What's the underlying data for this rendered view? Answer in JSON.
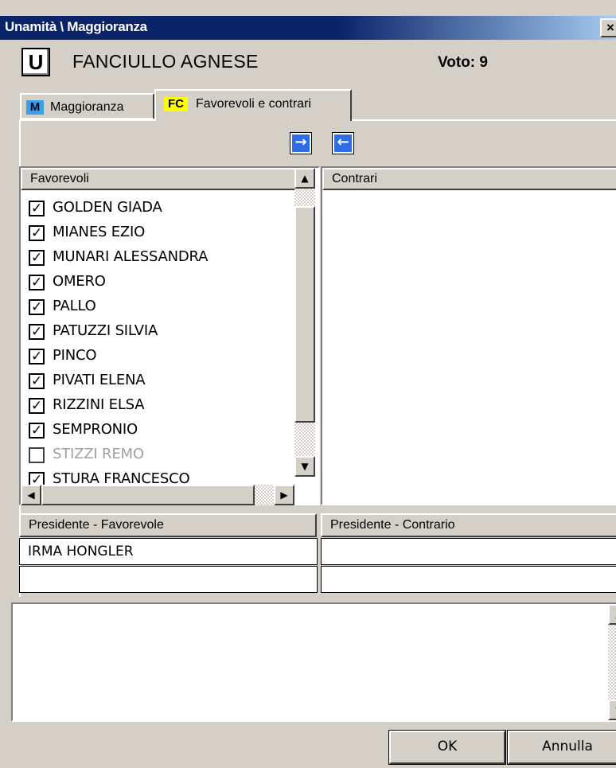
{
  "window": {
    "title": "Unamità \\ Maggioranza",
    "close_label": "×"
  },
  "header": {
    "badge": "U",
    "person_name": "FANCIULLO AGNESE",
    "vote": "Voto: 9"
  },
  "tabs": [
    {
      "badge": "M",
      "label": "Maggioranza",
      "badge_color": "#3aa0e8",
      "active": false
    },
    {
      "badge": "FC",
      "label": "Favorevoli e contrari",
      "badge_color": "#ffff00",
      "active": true
    }
  ],
  "toolbar": {
    "to_contrari_icon": "arrow-right-icon",
    "to_favorevoli_icon": "arrow-left-icon",
    "icon_color": "#2d6ee6"
  },
  "favorevoli": {
    "header": "Favorevoli",
    "items": [
      {
        "name": "GOLDEN GIADA",
        "checked": true
      },
      {
        "name": "MIANES EZIO",
        "checked": true
      },
      {
        "name": "MUNARI ALESSANDRA",
        "checked": true
      },
      {
        "name": "OMERO",
        "checked": true
      },
      {
        "name": "PALLO",
        "checked": true
      },
      {
        "name": "PATUZZI SILVIA",
        "checked": true
      },
      {
        "name": "PINCO",
        "checked": true
      },
      {
        "name": "PIVATI ELENA",
        "checked": true
      },
      {
        "name": "RIZZINI ELSA",
        "checked": true
      },
      {
        "name": "SEMPRONIO",
        "checked": true
      },
      {
        "name": "STIZZI REMO",
        "checked": false
      },
      {
        "name": "STURA FRANCESCO",
        "checked": true
      }
    ]
  },
  "contrari": {
    "header": "Contrari",
    "items": []
  },
  "presidente": {
    "fav_header": "Presidente - Favorevole",
    "con_header": "Presidente - Contrario",
    "fav_value": "IRMA HONGLER",
    "con_value": ""
  },
  "buttons": {
    "ok": "OK",
    "cancel": "Annulla"
  },
  "colors": {
    "title_bar": "#0a246a",
    "window_bg": "#d4d0c8"
  }
}
